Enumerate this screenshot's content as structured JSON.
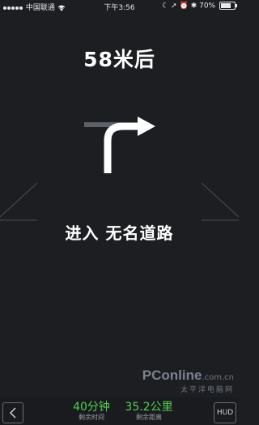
{
  "status_bar": {
    "carrier": "中国联通",
    "time": "下午3:56",
    "battery": "70%"
  },
  "nav": {
    "distance": "58米后",
    "maneuver_icon": "turn-right-arrow-icon",
    "road_label": "进入 无名道路"
  },
  "watermark": {
    "logo": "PConline",
    "domain": ".com.cn",
    "subtitle": "太平洋电脑网"
  },
  "bottom_bar": {
    "back_icon": "chevron-left-icon",
    "remaining_time": "40分钟",
    "remaining_time_label": "剩余时间",
    "remaining_distance": "35.2公里",
    "remaining_distance_label": "剩余距离",
    "hud_label": "HUD"
  },
  "colors": {
    "background": "#1c1e22",
    "stat_green": "#57cf53"
  }
}
